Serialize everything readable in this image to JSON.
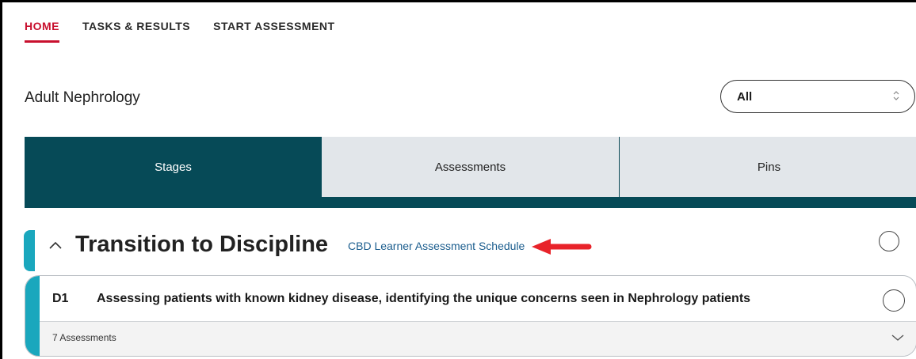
{
  "nav": {
    "tabs": [
      {
        "label": "HOME",
        "active": true
      },
      {
        "label": "TASKS & RESULTS",
        "active": false
      },
      {
        "label": "START ASSESSMENT",
        "active": false
      }
    ]
  },
  "program": {
    "title": "Adult Nephrology"
  },
  "filter": {
    "selected": "All"
  },
  "view_tabs": [
    {
      "label": "Stages",
      "active": true
    },
    {
      "label": "Assessments",
      "active": false
    },
    {
      "label": "Pins",
      "active": false
    }
  ],
  "stage": {
    "title": "Transition to Discipline",
    "schedule_link": "CBD Learner Assessment Schedule"
  },
  "epa": {
    "code": "D1",
    "title": "Assessing patients with known kidney disease, identifying the unique concerns seen in Nephrology patients",
    "assessments_count": "7 Assessments"
  },
  "colors": {
    "accent_red": "#c8102e",
    "brand_teal_dark": "#064a57",
    "accent_teal": "#1aa7bd",
    "link_blue": "#1b5d8e",
    "annotation_arrow": "#e8232a"
  },
  "icons": {
    "collapse": "chevron-up-icon",
    "expand": "chevron-down-icon",
    "select": "updown-chevron-icon",
    "complete": "circle-checkbox-icon"
  }
}
